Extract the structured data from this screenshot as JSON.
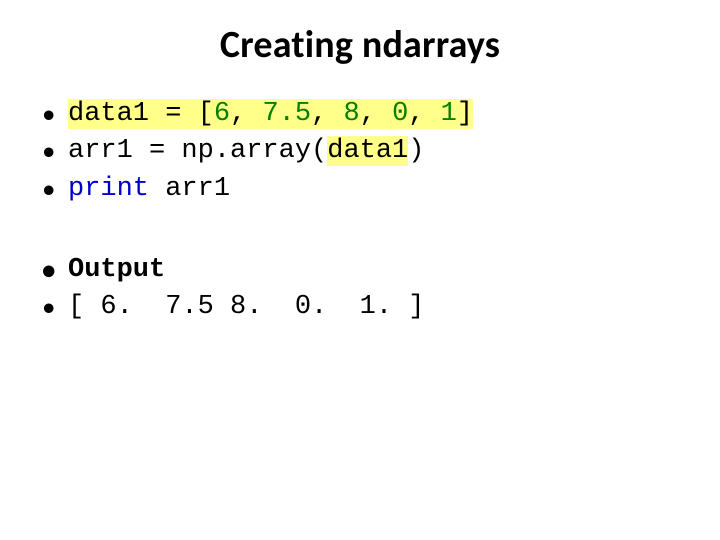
{
  "title": "Creating ndarrays",
  "code": {
    "l1": {
      "pre": "data1 = [",
      "n1": "6",
      "c1": ", ",
      "n2": "7.5",
      "c2": ", ",
      "n3": "8",
      "c3": ", ",
      "n4": "0",
      "c4": ", ",
      "n5": "1",
      "post": "]"
    },
    "l2": {
      "a": "arr1 = np.array(",
      "b": "data1",
      "c": ")"
    },
    "l3": {
      "kw": "print",
      "rest": " arr1"
    }
  },
  "output": {
    "label": "Output",
    "line": "[ 6.  7.5 8.  0.  1. ]"
  }
}
